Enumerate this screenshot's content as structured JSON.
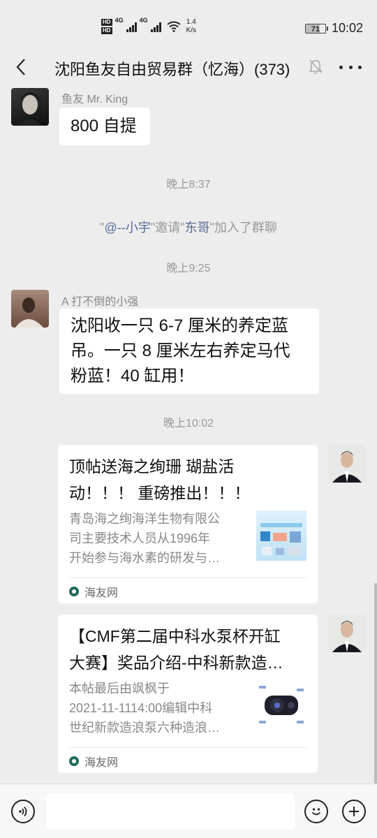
{
  "status_bar": {
    "hd1": "HD",
    "hd2": "HD",
    "net1": "4G",
    "net2": "4G",
    "speed_value": "1.4",
    "speed_unit": "K/s",
    "battery": "71",
    "time": "10:02"
  },
  "header": {
    "title": "沈阳鱼友自由贸易群（忆海）(373)"
  },
  "messages": {
    "m1": {
      "sender": "鱼友 Mr. King",
      "text": "800 自提"
    },
    "t1": "晚上8:37",
    "sys": {
      "q1": "\"",
      "a": "@--小宇",
      "q2": "\"邀请\"",
      "b": "东哥",
      "q3": "\"加入了群聊"
    },
    "t2": "晚上9:25",
    "m2": {
      "sender": "A  打不倒的小强",
      "line1": "沈阳收一只 6-7 厘米的养定蓝",
      "line2": "吊。一只 8 厘米左右养定马代",
      "line3": "粉蓝！40 缸用！"
    },
    "t3": "晚上10:02",
    "card1": {
      "title1": "顶帖送海之绚珊 瑚盐活",
      "title2": "动！！！ 重磅推出！！！",
      "desc1": "青岛海之绚海洋生物有限公",
      "desc2": "司主要技术人员从1996年",
      "desc3": "开始参与海水素的研发与…",
      "source": "海友网"
    },
    "card2": {
      "title1": "【CMF第二届中科水泵杯开缸",
      "title2": "大赛】奖品介绍-中科新款造…",
      "desc1": "本帖最后由飒枫于",
      "desc2": "2021-11-1114:00编辑中科",
      "desc3": "世纪新款造浪泵六种造浪…",
      "source": "海友网"
    }
  }
}
